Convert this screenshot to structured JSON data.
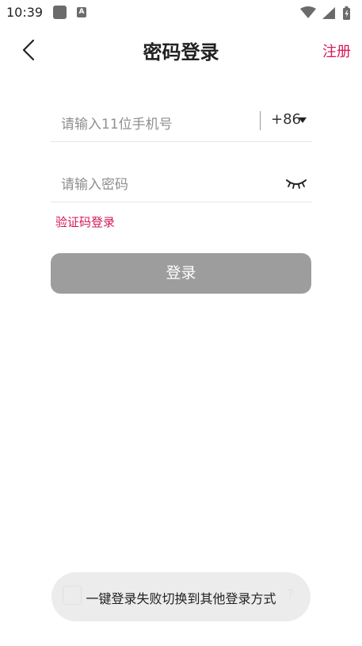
{
  "status_bar": {
    "time": "10:39"
  },
  "header": {
    "title": "密码登录",
    "register_label": "注册"
  },
  "form": {
    "phone_placeholder": "请输入11位手机号",
    "country_code": "+86",
    "password_placeholder": "请输入密码"
  },
  "sms_login_label": "验证码登录",
  "login_button_label": "登录",
  "toast": {
    "message": "一键登录失败切换到其他登录方式"
  },
  "colors": {
    "accent": "#d6175c",
    "button_disabled": "#9d9d9d",
    "toast_bg": "#ececec"
  },
  "icons": [
    "back-icon",
    "eye-closed-icon",
    "wifi-icon",
    "signal-icon",
    "battery-icon"
  ]
}
